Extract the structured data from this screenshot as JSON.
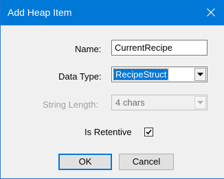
{
  "window": {
    "title": "Add Heap Item",
    "close_icon": "close-icon"
  },
  "form": {
    "name_label": "Name:",
    "name_value": "CurrentRecipe",
    "data_type_label": "Data Type:",
    "data_type_value": "RecipeStruct",
    "string_length_label": "String Length:",
    "string_length_value": "4 chars",
    "string_length_enabled": false,
    "is_retentive_label": "Is Retentive",
    "is_retentive_checked": true
  },
  "buttons": {
    "ok_label": "OK",
    "cancel_label": "Cancel"
  },
  "colors": {
    "titlebar": "#0078d7",
    "selection": "#0078d7",
    "disabled_text": "#a0a0a0"
  }
}
